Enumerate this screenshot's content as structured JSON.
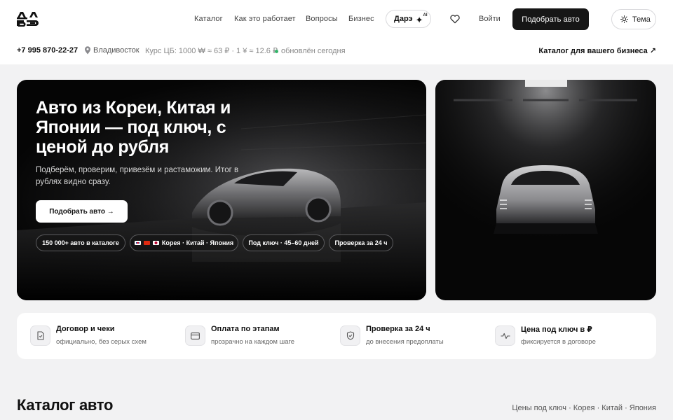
{
  "header": {
    "logo_alt": "ДАРЭ",
    "nav": [
      "Каталог",
      "Как это работает",
      "Вопросы",
      "Бизнес"
    ],
    "ai_button": "Дарэ",
    "ai_tag": "AI",
    "login": "Войти",
    "cta": "Подобрать авто",
    "theme": "Тема"
  },
  "infobar": {
    "phone": "+7 995 870-22-27",
    "city": "Владивосток",
    "rate": "Курс ЦБ: 1000 ₩ ≈ 63 ₽ · 1 ¥ ≈ 12.6 ₽",
    "updated": "обновлён сегодня",
    "business_link": "Каталог для вашего бизнеса ↗"
  },
  "hero": {
    "title": "Авто из Кореи, Китая и Японии — под ключ, с ценой до рубля",
    "subtitle": "Подберём, проверим, привезём и растаможим. Итог в рублях видно сразу.",
    "button": "Подобрать авто →",
    "chips": [
      "150 000+ авто в каталоге",
      "Корея · Китай · Япония",
      "Под ключ · 45–60 дней",
      "Проверка за 24 ч"
    ]
  },
  "features": [
    {
      "title": "Договор и чеки",
      "subtitle": "официально, без серых схем",
      "icon": "document-icon"
    },
    {
      "title": "Оплата по этапам",
      "subtitle": "прозрачно на каждом шаге",
      "icon": "card-icon"
    },
    {
      "title": "Проверка за 24 ч",
      "subtitle": "до внесения предоплаты",
      "icon": "shield-icon"
    },
    {
      "title": "Цена под ключ в ₽",
      "subtitle": "фиксируется в договоре",
      "icon": "pulse-icon"
    }
  ],
  "catalog": {
    "title": "Каталог авто",
    "subtitle": "Цены под ключ · Корея · Китай · Япония"
  }
}
